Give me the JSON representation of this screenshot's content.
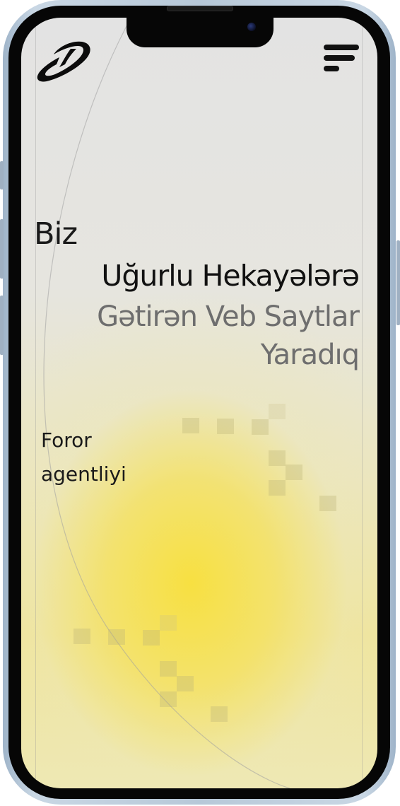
{
  "header": {
    "logo_name": "brand-logo",
    "menu_icon": "hamburger-menu-icon"
  },
  "hero": {
    "line1": "Biz",
    "line2": "Uğurlu Hekayələrə",
    "line3": "Gətirən Veb Saytlar",
    "line4": "Yaradıq"
  },
  "agency": {
    "line1": "Foror",
    "line2": "agentliyi"
  },
  "colors": {
    "accent_yellow": "#f5df4d",
    "text_dark": "#111111",
    "text_gray": "#6e6e6e",
    "background": "#e3e3e3"
  }
}
